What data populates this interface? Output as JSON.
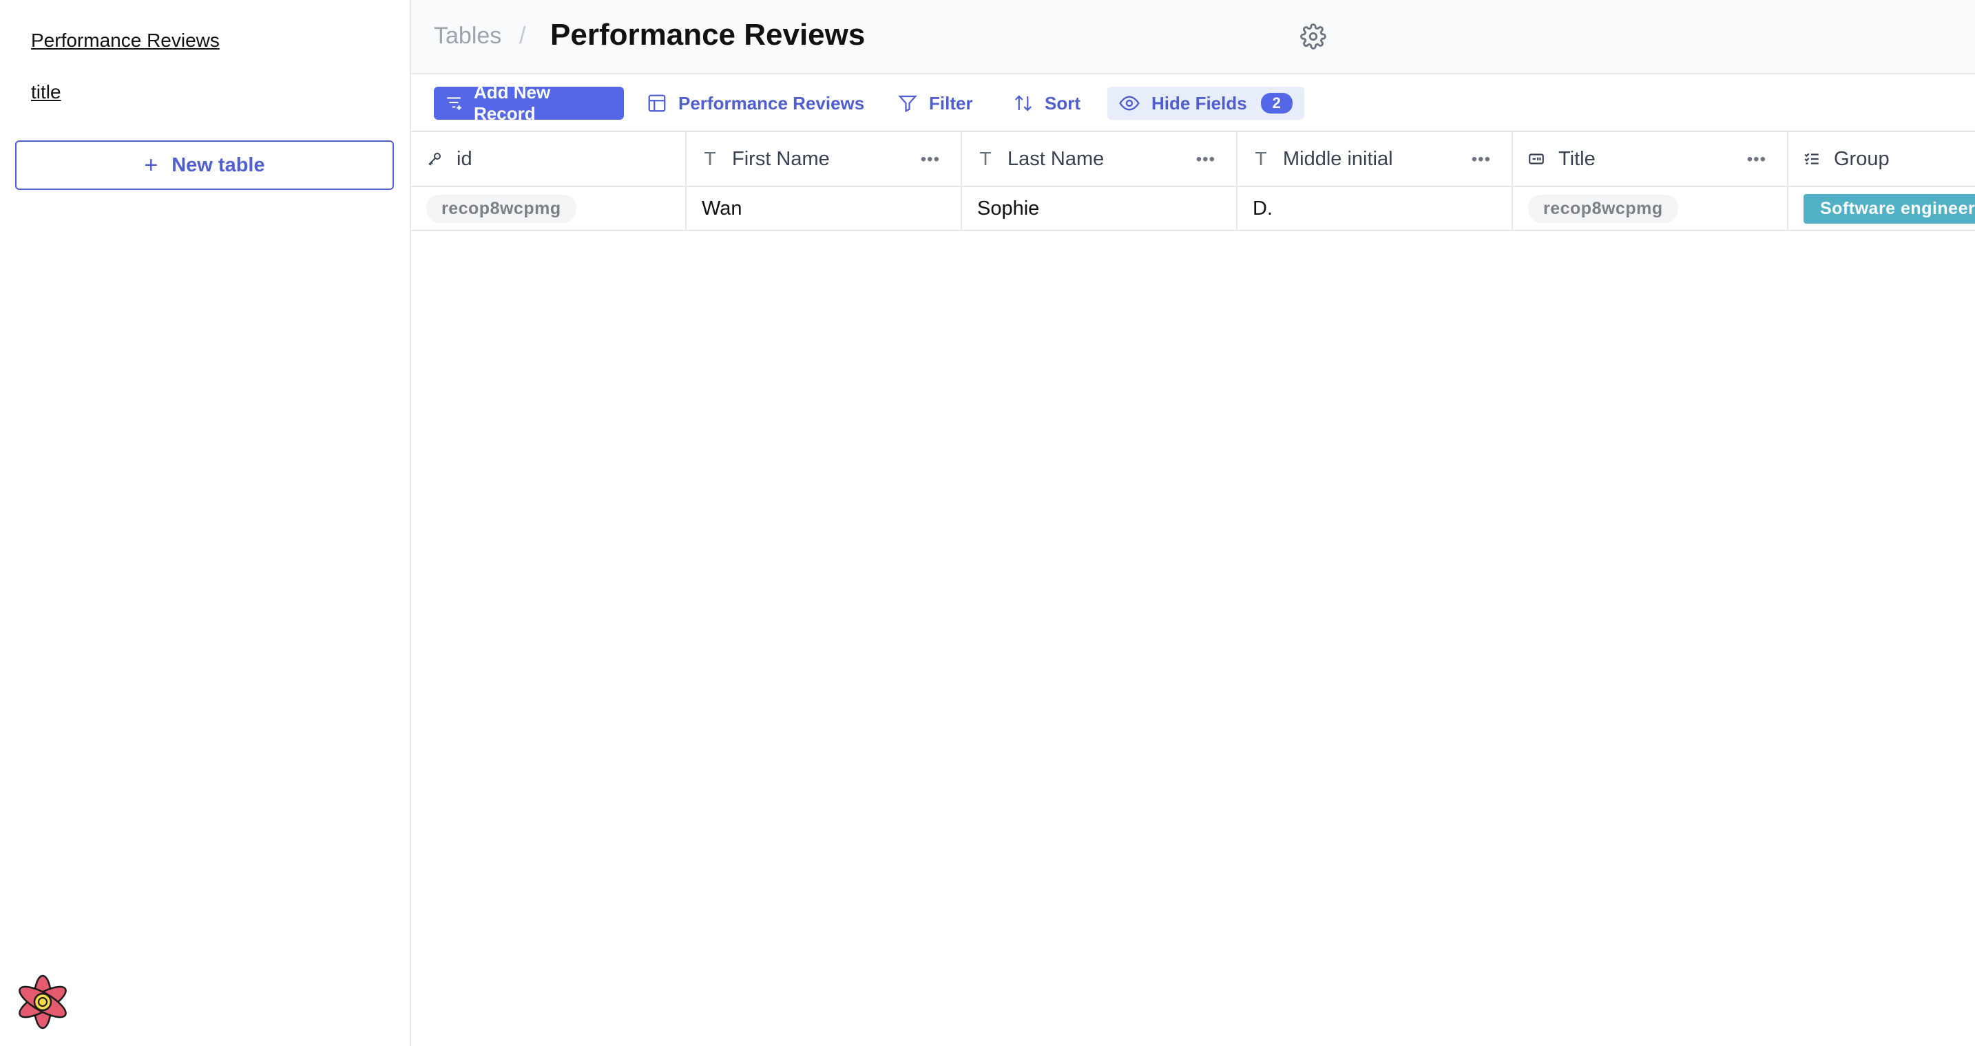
{
  "sidebar": {
    "links": [
      "Performance Reviews",
      "title"
    ],
    "new_table_label": "New table"
  },
  "header": {
    "breadcrumb_root": "Tables",
    "breadcrumb_sep": "/",
    "title": "Performance Reviews"
  },
  "toolbar": {
    "add_label": "Add New Record",
    "view_label": "Performance Reviews",
    "filter_label": "Filter",
    "sort_label": "Sort",
    "hide_label": "Hide Fields",
    "hide_count": "2"
  },
  "columns": [
    {
      "label": "id",
      "type_icon": "key-icon"
    },
    {
      "label": "First Name",
      "type_icon": "text-icon"
    },
    {
      "label": "Last Name",
      "type_icon": "text-icon"
    },
    {
      "label": "Middle initial",
      "type_icon": "text-icon"
    },
    {
      "label": "Title",
      "type_icon": "link-record-icon"
    },
    {
      "label": "Group",
      "type_icon": "multi-select-icon"
    }
  ],
  "rows": [
    {
      "id": "recop8wcpmg",
      "first_name": "Wan",
      "last_name": "Sophie",
      "middle_initial": "D.",
      "title": "recop8wcpmg",
      "group": "Software engineer"
    }
  ],
  "colors": {
    "accent": "#5468e7",
    "accent_text": "#4f5fcf",
    "tag": "#4fb0c6"
  }
}
